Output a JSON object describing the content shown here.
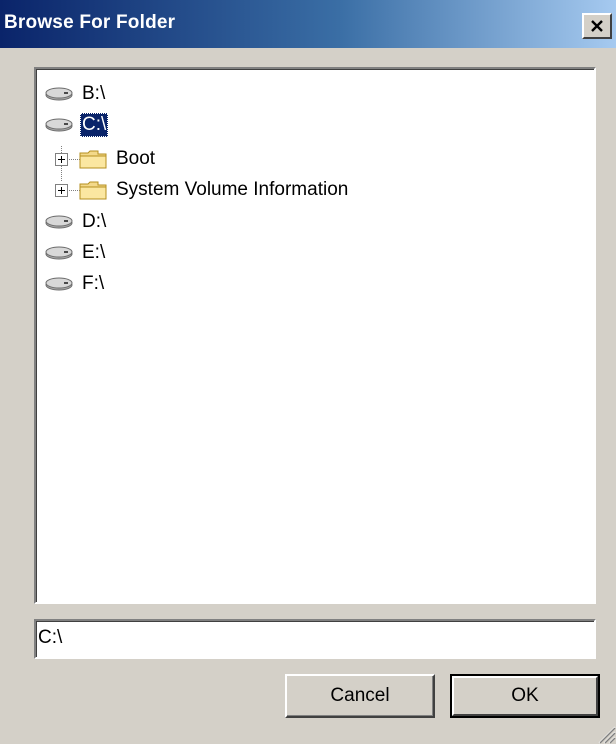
{
  "window": {
    "title": "Browse For Folder",
    "close_glyph": "✕"
  },
  "tree": {
    "items": [
      {
        "label": "B:\\",
        "icon": "drive-icon",
        "level": 0,
        "selected": false
      },
      {
        "label": "C:\\",
        "icon": "drive-icon",
        "level": 0,
        "selected": true
      },
      {
        "label": "Boot",
        "icon": "folder-icon",
        "level": 1,
        "expandable": true
      },
      {
        "label": "System Volume Information",
        "icon": "folder-icon",
        "level": 1,
        "expandable": true
      },
      {
        "label": "D:\\",
        "icon": "drive-icon",
        "level": 0,
        "selected": false
      },
      {
        "label": "E:\\",
        "icon": "drive-icon",
        "level": 0,
        "selected": false
      },
      {
        "label": "F:\\",
        "icon": "drive-icon",
        "level": 0,
        "selected": false
      }
    ]
  },
  "path_field": {
    "value": "C:\\"
  },
  "buttons": {
    "cancel_label": "Cancel",
    "ok_label": "OK"
  },
  "colors": {
    "title_gradient_start": "#0a246a",
    "title_gradient_end": "#a6caf0",
    "selection_bg": "#0a246a",
    "face": "#d4d0c8"
  }
}
